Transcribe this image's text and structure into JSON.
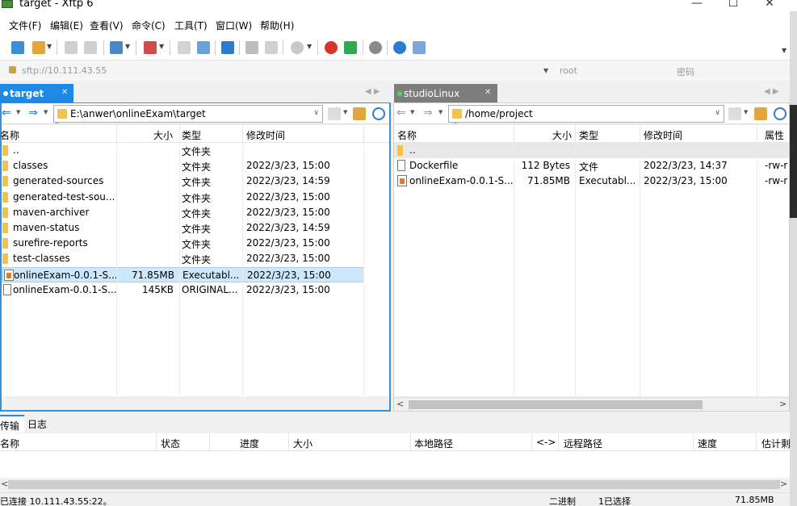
{
  "window": {
    "title": "target - Xftp 6",
    "minimize": "—",
    "maximize": "☐",
    "close": "✕"
  },
  "menu": [
    "文件(F)",
    "编辑(E)",
    "查看(V)",
    "命令(C)",
    "工具(T)",
    "窗口(W)",
    "帮助(H)"
  ],
  "address": {
    "url": "sftp://10.111.43.55",
    "user_placeholder": "root",
    "password_placeholder": "密码"
  },
  "left_pane": {
    "tab": "target",
    "path": "E:\\anwer\\onlineExam\\target",
    "columns": [
      "名称",
      "大小",
      "类型",
      "修改时间"
    ],
    "rows": [
      {
        "name": "..",
        "size": "",
        "type": "文件夹",
        "modified": "",
        "icon": "folder-icon"
      },
      {
        "name": "classes",
        "size": "",
        "type": "文件夹",
        "modified": "2022/3/23, 15:00",
        "icon": "folder-icon"
      },
      {
        "name": "generated-sources",
        "size": "",
        "type": "文件夹",
        "modified": "2022/3/23, 14:59",
        "icon": "folder-icon"
      },
      {
        "name": "generated-test-sou...",
        "size": "",
        "type": "文件夹",
        "modified": "2022/3/23, 15:00",
        "icon": "folder-icon"
      },
      {
        "name": "maven-archiver",
        "size": "",
        "type": "文件夹",
        "modified": "2022/3/23, 15:00",
        "icon": "folder-icon"
      },
      {
        "name": "maven-status",
        "size": "",
        "type": "文件夹",
        "modified": "2022/3/23, 14:59",
        "icon": "folder-icon"
      },
      {
        "name": "surefire-reports",
        "size": "",
        "type": "文件夹",
        "modified": "2022/3/23, 15:00",
        "icon": "folder-icon"
      },
      {
        "name": "test-classes",
        "size": "",
        "type": "文件夹",
        "modified": "2022/3/23, 15:00",
        "icon": "folder-icon"
      },
      {
        "name": "onlineExam-0.0.1-S...",
        "size": "71.85MB",
        "type": "Executabl...",
        "modified": "2022/3/23, 15:00",
        "icon": "jar-icon"
      },
      {
        "name": "onlineExam-0.0.1-S...",
        "size": "145KB",
        "type": "ORIGINAL...",
        "modified": "2022/3/23, 15:00",
        "icon": "file-icon"
      }
    ]
  },
  "right_pane": {
    "tab": "studioLinux",
    "path": "/home/project",
    "columns": [
      "名称",
      "大小",
      "类型",
      "修改时间",
      "属性"
    ],
    "rows": [
      {
        "name": "..",
        "size": "",
        "type": "",
        "modified": "",
        "attr": "",
        "icon": "folder-icon"
      },
      {
        "name": "Dockerfile",
        "size": "112 Bytes",
        "type": "文件",
        "modified": "2022/3/23, 14:37",
        "attr": "-rw-r",
        "icon": "file-icon"
      },
      {
        "name": "onlineExam-0.0.1-S...",
        "size": "71.85MB",
        "type": "Executabl...",
        "modified": "2022/3/23, 15:00",
        "attr": "-rw-r",
        "icon": "jar-icon"
      }
    ]
  },
  "transfer": {
    "tabs": [
      "传输",
      "日志"
    ],
    "columns": [
      "名称",
      "状态",
      "进度",
      "大小",
      "本地路径",
      "<->",
      "远程路径",
      "速度",
      "估计剩"
    ]
  },
  "status": {
    "connection": "已连接 10.111.43.55:22。",
    "mode": "二进制",
    "selection": "1已选择",
    "size": "71.85MB"
  },
  "colors": {
    "active_tab": "#1e88e5",
    "inactive_tab": "#7d7d7d",
    "selection": "#cce8ff",
    "folder": "#f2c14e"
  }
}
